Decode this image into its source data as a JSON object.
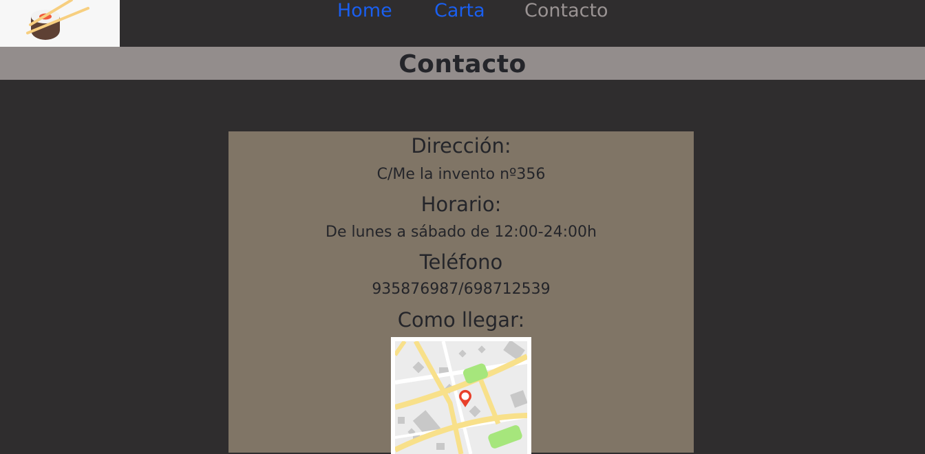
{
  "nav": {
    "home": "Home",
    "carta": "Carta",
    "contacto": "Contacto"
  },
  "page_title": "Contacto",
  "contact": {
    "direccion_heading": "Dirección:",
    "direccion_value": "C/Me la invento nº356",
    "horario_heading": "Horario:",
    "horario_value": "De lunes a sábado de 12:00-24:00h",
    "telefono_heading": "Teléfono",
    "telefono_value": "935876987/698712539",
    "como_llegar_heading": "Como llegar:"
  },
  "colors": {
    "nav_link": "#1a5ff0",
    "nav_active": "#9a9393",
    "background": "#2f2d2e",
    "title_bar": "#938d8c",
    "card": "#807566",
    "text": "#24252a"
  },
  "icons": {
    "logo": "sushi-roll-logo",
    "map": "city-map-with-pin"
  }
}
